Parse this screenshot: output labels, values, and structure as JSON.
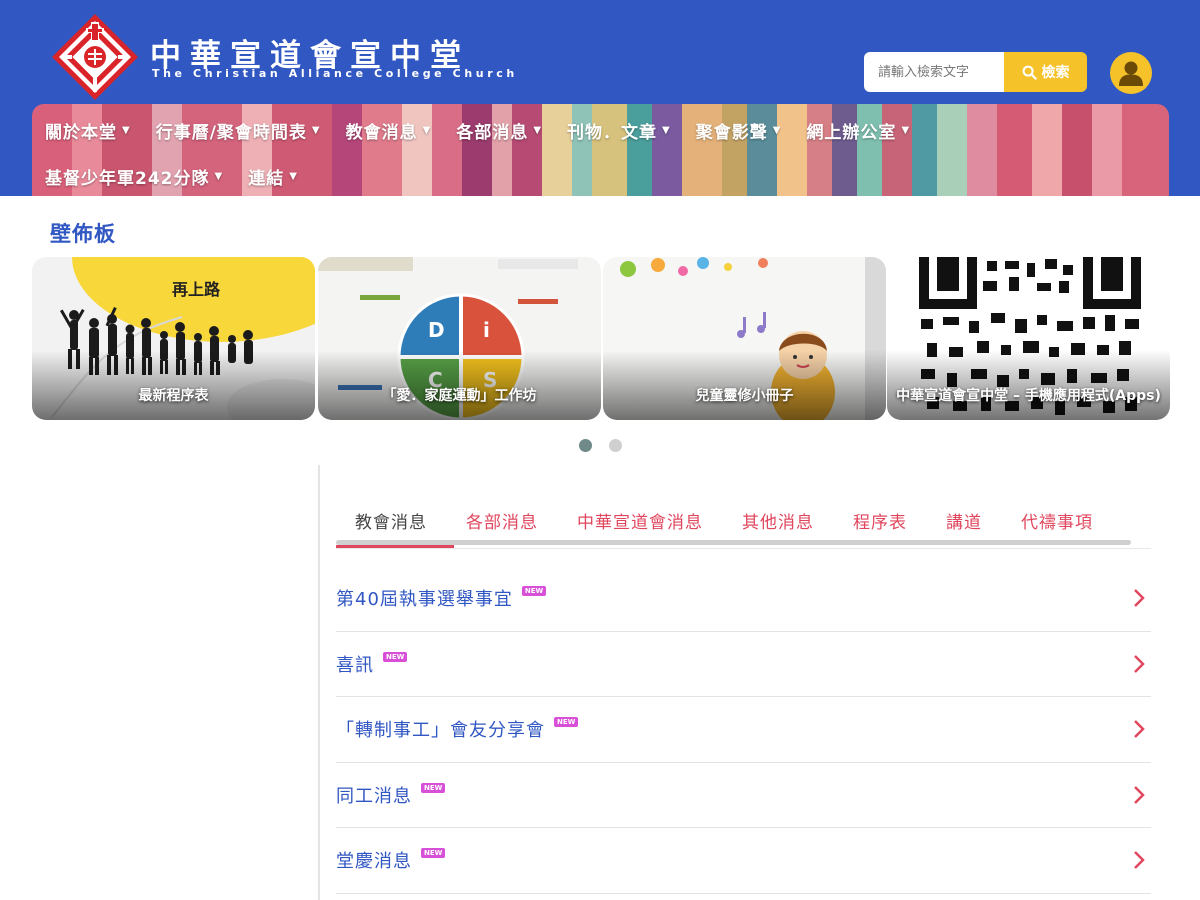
{
  "header": {
    "title": "中華宣道會宣中堂",
    "subtitle": "The Christian Alliance College Church",
    "search": {
      "placeholder": "請輸入檢索文字",
      "button_label": "檢索"
    },
    "colors": {
      "header_bg": "#3157c3",
      "accent": "#f6c22a"
    }
  },
  "nav": {
    "row1": [
      "關於本堂",
      "行事曆/聚會時間表",
      "教會消息",
      "各部消息",
      "刊物．文章",
      "聚會影聲",
      "網上辦公室"
    ],
    "row2": [
      "基督少年軍242分隊",
      "連結"
    ]
  },
  "bulletin": {
    "title": "壁佈板",
    "cards": [
      {
        "caption": "最新程序表",
        "art_text": "再上路"
      },
      {
        "caption": "「愛．家庭運動」工作坊",
        "art_text": [
          "D",
          "i",
          "C",
          "S"
        ]
      },
      {
        "caption": "兒童靈修小冊子"
      },
      {
        "caption": "中華宣道會宣中堂 – 手機應用程式(Apps)"
      }
    ],
    "pagination": {
      "total": 2,
      "active": 1
    }
  },
  "tabs": {
    "items": [
      "教會消息",
      "各部消息",
      "中華宣道會消息",
      "其他消息",
      "程序表",
      "講道",
      "代禱事項"
    ],
    "active": "教會消息"
  },
  "news": {
    "badge": "NEW",
    "items": [
      "第40屆執事選舉事宜",
      "喜訊",
      "「轉制事工」會友分享會",
      "同工消息",
      "堂慶消息"
    ]
  }
}
